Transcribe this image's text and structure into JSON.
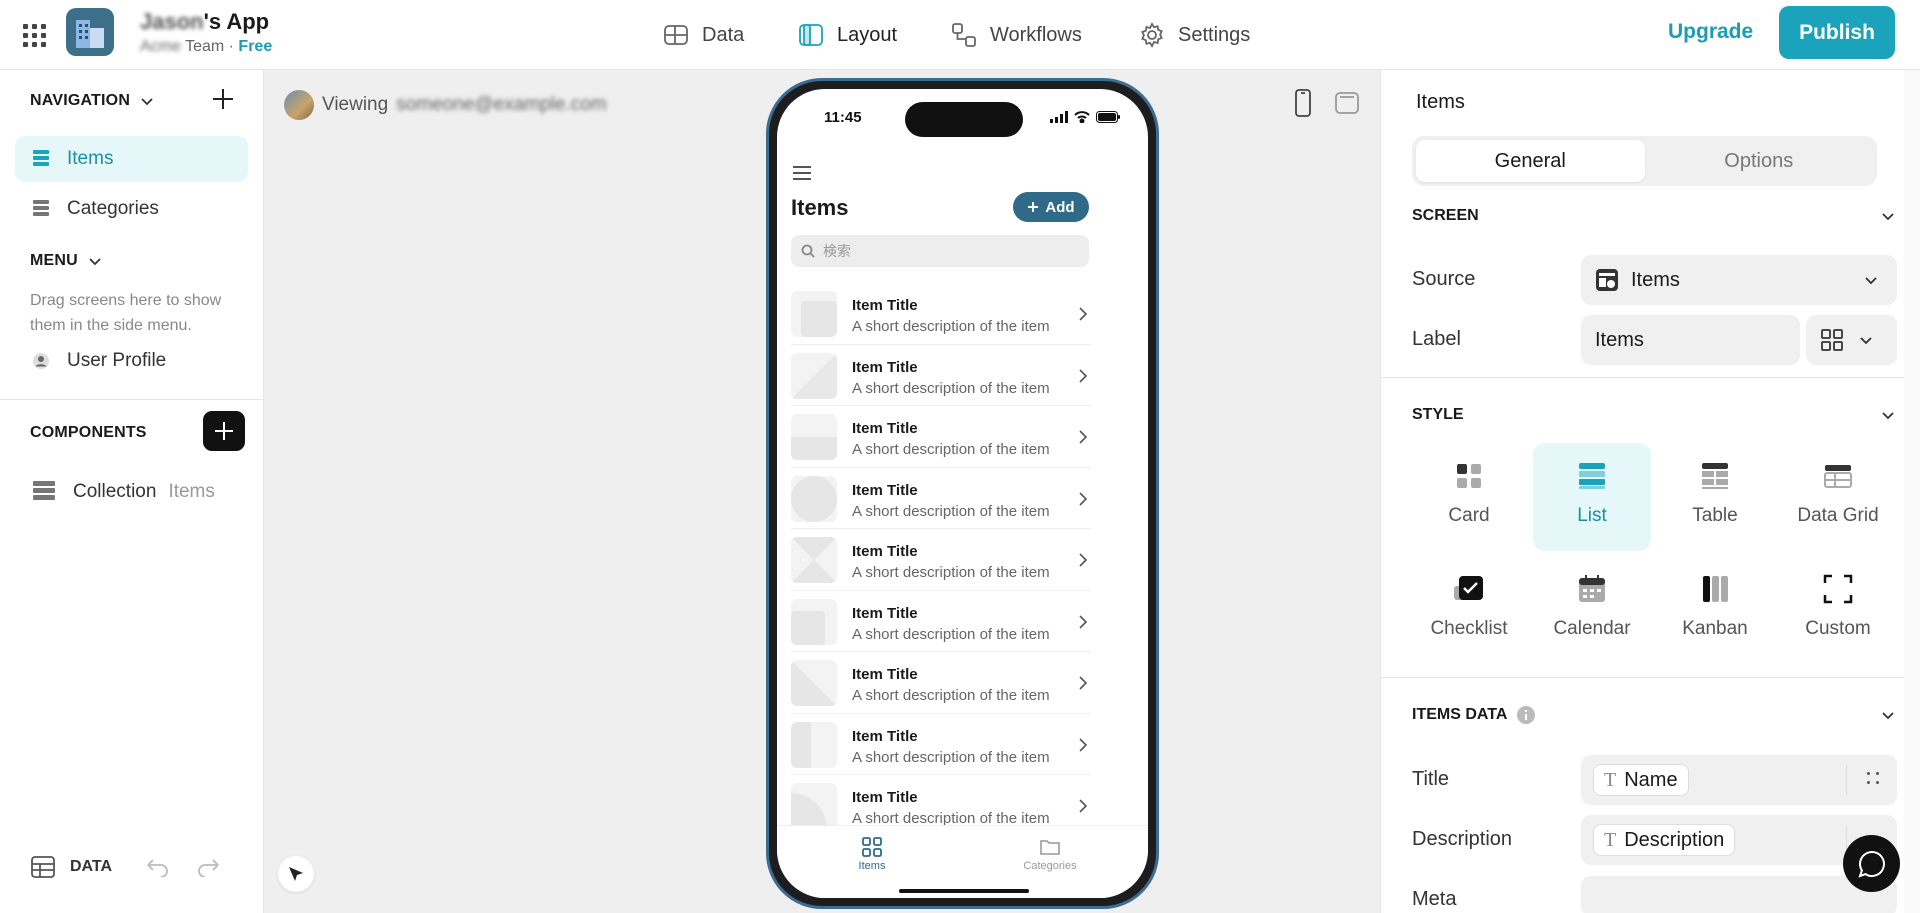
{
  "header": {
    "app_name": "'s App",
    "app_name_blurred": "Jason",
    "team_blurred": "Acme",
    "team_label": "Team",
    "separator": "·",
    "plan": "Free",
    "tabs": [
      {
        "label": "Data",
        "icon": "data-table-icon"
      },
      {
        "label": "Layout",
        "icon": "layout-icon"
      },
      {
        "label": "Workflows",
        "icon": "workflows-icon"
      },
      {
        "label": "Settings",
        "icon": "gear-icon"
      }
    ],
    "active_tab": "Layout",
    "upgrade_label": "Upgrade",
    "publish_label": "Publish"
  },
  "sidebar": {
    "navigation_label": "NAVIGATION",
    "nav_items": [
      {
        "label": "Items",
        "active": true
      },
      {
        "label": "Categories",
        "active": false
      }
    ],
    "menu_label": "MENU",
    "menu_hint": "Drag screens here to show them in the side menu.",
    "menu_items": [
      {
        "label": "User Profile"
      }
    ],
    "components_label": "COMPONENTS",
    "components": [
      {
        "label": "Collection",
        "source": "Items"
      }
    ],
    "bottom_data_label": "DATA"
  },
  "canvas": {
    "viewing_label": "Viewing",
    "viewing_user_blurred": "someone@example.com"
  },
  "phone": {
    "time": "11:45",
    "title": "Items",
    "add_label": "Add",
    "search_placeholder": "検索",
    "rows": [
      {
        "title": "Item Title",
        "description": "A short description of the item"
      },
      {
        "title": "Item Title",
        "description": "A short description of the item"
      },
      {
        "title": "Item Title",
        "description": "A short description of the item"
      },
      {
        "title": "Item Title",
        "description": "A short description of the item"
      },
      {
        "title": "Item Title",
        "description": "A short description of the item"
      },
      {
        "title": "Item Title",
        "description": "A short description of the item"
      },
      {
        "title": "Item Title",
        "description": "A short description of the item"
      },
      {
        "title": "Item Title",
        "description": "A short description of the item"
      },
      {
        "title": "Item Title",
        "description": "A short description of the item"
      }
    ],
    "tabbar": [
      {
        "label": "Items",
        "active": true
      },
      {
        "label": "Categories",
        "active": false
      }
    ]
  },
  "panel": {
    "title": "Items",
    "segments": [
      {
        "label": "General",
        "active": true
      },
      {
        "label": "Options",
        "active": false
      }
    ],
    "screen_section": "SCREEN",
    "source_label": "Source",
    "source_value": "Items",
    "label_label": "Label",
    "label_value": "Items",
    "style_section": "STYLE",
    "styles": [
      {
        "label": "Card",
        "icon": "card-style-icon",
        "active": false
      },
      {
        "label": "List",
        "icon": "list-style-icon",
        "active": true
      },
      {
        "label": "Table",
        "icon": "table-style-icon",
        "active": false
      },
      {
        "label": "Data Grid",
        "icon": "data-grid-style-icon",
        "active": false
      },
      {
        "label": "Checklist",
        "icon": "checklist-style-icon",
        "active": false
      },
      {
        "label": "Calendar",
        "icon": "calendar-style-icon",
        "active": false
      },
      {
        "label": "Kanban",
        "icon": "kanban-style-icon",
        "active": false
      },
      {
        "label": "Custom",
        "icon": "custom-style-icon",
        "active": false
      }
    ],
    "items_data_section": "ITEMS DATA",
    "title_label": "Title",
    "title_value": "Name",
    "description_label": "Description",
    "description_value": "Description",
    "meta_label": "Meta"
  },
  "colors": {
    "accent": "#1aa3bb",
    "accent_light": "#e6f7fa",
    "phone_accent": "#2f6b88"
  }
}
